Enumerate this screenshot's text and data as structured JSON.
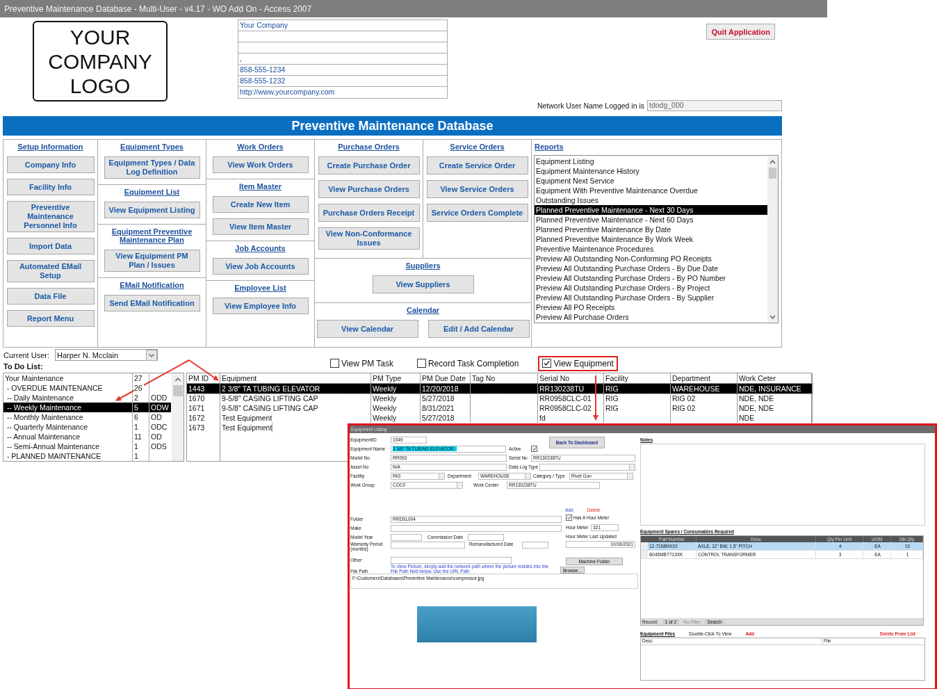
{
  "window": {
    "title": "Preventive Maintenance Database - Multi-User - v4.17 - WO Add On - Access 2007"
  },
  "logo": {
    "lines": [
      "YOUR",
      "COMPANY",
      "LOGO"
    ]
  },
  "company_info": [
    {
      "kind": "text",
      "value": "Your Company"
    },
    {
      "kind": "blank"
    },
    {
      "kind": "blank"
    },
    {
      "kind": "text",
      "value": ","
    },
    {
      "kind": "text",
      "value": "858-555-1234"
    },
    {
      "kind": "text",
      "value": "858-555-1232"
    },
    {
      "kind": "text",
      "value": "http://www.yourcompany.com"
    }
  ],
  "quit_button": "Quit Application",
  "network_user": {
    "label": "Network User Name Logged in is",
    "value": "tdodg_000"
  },
  "banner": "Preventive Maintenance Database",
  "menu_columns": [
    [
      {
        "heading": "Setup Information",
        "buttons": [
          "Company Info",
          "Facility Info",
          "Preventive Maintenance Personnel Info",
          "Import Data",
          "Automated EMail Setup",
          "Data File",
          "Report Menu"
        ]
      }
    ],
    [
      {
        "heading": "Equipment Types",
        "buttons": [
          "Equipment Types / Data Log Definition"
        ]
      },
      {
        "heading": "Equipment List",
        "buttons": [
          "View Equipment Listing"
        ]
      },
      {
        "heading": "Equipment Preventive Maintenance Plan",
        "buttons": [
          "View Equipment PM Plan / Issues"
        ]
      },
      {
        "heading": "EMail Notification",
        "buttons": [
          "Send EMail Notification"
        ]
      }
    ],
    [
      {
        "heading": "Work Orders",
        "buttons": [
          "View Work Orders"
        ]
      },
      {
        "heading": "Item Master",
        "buttons": [
          "Create New Item",
          "View Item Master"
        ]
      },
      {
        "heading": "Job Accounts",
        "buttons": [
          "View Job Accounts"
        ]
      },
      {
        "heading": "Employee List",
        "buttons": [
          "View Employee Info"
        ]
      }
    ]
  ],
  "order_columns": [
    {
      "heading": "Purchase Orders",
      "buttons": [
        "Create Purchase Order",
        "View Purchase Orders",
        "Purchase Orders Receipt",
        "View Non-Conformance Issues"
      ]
    },
    {
      "heading": "Service Orders",
      "buttons": [
        "Create Service Order",
        "View Service Orders",
        "Service Orders Complete"
      ]
    }
  ],
  "wide_sections": [
    {
      "heading": "Suppliers",
      "buttons": [
        "View Suppliers"
      ]
    },
    {
      "heading": "Calendar",
      "buttons": [
        "View Calendar",
        "Edit / Add Calendar"
      ]
    }
  ],
  "reports": {
    "heading": "Reports",
    "items": [
      {
        "label": "Equipment Listing",
        "selected": false
      },
      {
        "label": "Equipment Maintenance History",
        "selected": false
      },
      {
        "label": "Equipment Next Service",
        "selected": false
      },
      {
        "label": "Equipment With Preventive Maintenance Overdue",
        "selected": false
      },
      {
        "label": "Outstanding Issues",
        "selected": false
      },
      {
        "label": "Planned Preventive Maintenance - Next 30 Days",
        "selected": true
      },
      {
        "label": "Planned Preventive Maintenance - Next 60 Days",
        "selected": false
      },
      {
        "label": "Planned Preventive Maintenance By Date",
        "selected": false
      },
      {
        "label": "Planned Preventive Maintenance By Work Week",
        "selected": false
      },
      {
        "label": "Preventive Maintenance Procedures",
        "selected": false
      },
      {
        "label": "Preview All Outstanding Non-Conforming PO Receipts",
        "selected": false
      },
      {
        "label": "Preview All Outstanding Purchase Orders - By Due Date",
        "selected": false
      },
      {
        "label": "Preview All Outstanding Purchase Orders - By PO Number",
        "selected": false
      },
      {
        "label": "Preview All Outstanding Purchase Orders - By Project",
        "selected": false
      },
      {
        "label": "Preview All Outstanding Purchase Orders - By Supplier",
        "selected": false
      },
      {
        "label": "Preview All PO Receipts",
        "selected": false
      },
      {
        "label": "Preview All Purchase Orders",
        "selected": false
      }
    ]
  },
  "current_user": {
    "label": "Current User:",
    "value": "Harper N. Mcclain"
  },
  "checkboxes": [
    {
      "label": "View PM Task",
      "checked": false,
      "highlighted": false
    },
    {
      "label": "Record Task Completion",
      "checked": false,
      "highlighted": false
    },
    {
      "label": "View Equipment",
      "checked": true,
      "highlighted": true
    }
  ],
  "todo": {
    "title": "To Do List:",
    "rows": [
      {
        "cells": [
          "Your Maintenance",
          "27"
        ],
        "selected": false
      },
      {
        "cells": [
          " - OVERDUE MAINTENANCE",
          "26"
        ],
        "selected": false
      },
      {
        "cells": [
          " -- Daily Maintenance",
          "2",
          "ODD"
        ],
        "selected": false
      },
      {
        "cells": [
          " -- Weekly Maintenance",
          "5",
          "ODW"
        ],
        "selected": true
      },
      {
        "cells": [
          " -- Monthly Maintenance",
          "6",
          "OD"
        ],
        "selected": false
      },
      {
        "cells": [
          " -- Quarterly Maintenance",
          "1",
          "ODC"
        ],
        "selected": false
      },
      {
        "cells": [
          " -- Annual Maintenance",
          "11",
          "OD"
        ],
        "selected": false
      },
      {
        "cells": [
          " -- Semi-Annual Maintenance",
          "1",
          "ODS"
        ],
        "selected": false
      },
      {
        "cells": [
          " - PLANNED MAINTENANCE",
          "1"
        ],
        "selected": false
      }
    ]
  },
  "pm_table": {
    "columns": [
      "PM ID",
      "Equipment",
      "PM Type",
      "PM Due Date",
      "Tag No",
      "Serial No",
      "Facility",
      "Department",
      "Work Ceter"
    ],
    "rows": [
      {
        "cells": [
          "1443",
          "2 3/8\" TA TUBING ELEVATOR",
          "Weekly",
          "12/20/2018",
          "",
          "RR130238TU",
          "RIG",
          "WAREHOUSE",
          "NDE, INSURANCE"
        ],
        "selected": true
      },
      {
        "cells": [
          "1670",
          "9-5/8\" CASING LIFTING CAP",
          "Weekly",
          "5/27/2018",
          "",
          "RR0958CLC-01",
          "RIG",
          "RIG 02",
          "NDE, NDE"
        ],
        "selected": false
      },
      {
        "cells": [
          "1671",
          "9-5/8\" CASING LIFTING CAP",
          "Weekly",
          "8/31/2021",
          "",
          "RR0958CLC-02",
          "RIG",
          "RIG 02",
          "NDE, NDE"
        ],
        "selected": false
      },
      {
        "cells": [
          "1672",
          "Test Equipment",
          "Weekly",
          "5/27/2018",
          "",
          "fd",
          "",
          "",
          "NDE"
        ],
        "selected": false
      },
      {
        "cells": [
          "1673",
          "Test Equipment"
        ],
        "selected": false
      }
    ]
  },
  "equipment_form": {
    "title": "Equipment Listing",
    "equipment_id": {
      "label": "EquipmentID",
      "value": "1049"
    },
    "equipment_name": {
      "label": "Equipment Name",
      "value": "2 3/8\" TA TUBING ELEVATOR",
      "text_selected": true
    },
    "active": {
      "label": "Active",
      "checked": true
    },
    "back_button": "Back To Dashboard",
    "model_no": {
      "label": "Model No",
      "value": "RR093"
    },
    "serial_no": {
      "label": "Serial No",
      "value": "RR130238TU"
    },
    "asset_no": {
      "label": "Asset No",
      "value": "N/A"
    },
    "data_log_type": {
      "label": "Data Log Type"
    },
    "facility": {
      "label": "Facility",
      "value": "RIG"
    },
    "department": {
      "label": "Department",
      "value": "WAREHOUSE"
    },
    "category_type": {
      "label": "Category / Type",
      "value": "Rivet Gun"
    },
    "work_group": {
      "label": "Work Group",
      "value": "COC0"
    },
    "work_center": {
      "label": "Work Center",
      "value": "RR130238TU"
    },
    "links": [
      {
        "kind": "add",
        "label": "Add"
      },
      {
        "kind": "delete",
        "label": "Delete"
      }
    ],
    "folder": {
      "label": "Folder",
      "value": "RRDSL004"
    },
    "make": {
      "label": "Make"
    },
    "model_year": {
      "label": "Model Year"
    },
    "commission_date": {
      "label": "Commission Date"
    },
    "warranty_period": {
      "label": "Warranty Period (months)"
    },
    "remanufactured_date": {
      "label": "Remanufactured Date"
    },
    "other": {
      "label": "Other:"
    },
    "has_hour_meter": {
      "label": "Has A Hour Meter",
      "checked": true
    },
    "hour_meter": {
      "label": "Hour Meter",
      "value": "321"
    },
    "hour_meter_updated": {
      "label": "Hour Meter Last Updated",
      "value": "10/16/2021"
    },
    "machine_folder_button": "Machine Folder",
    "picture_hint": "To View Picture, simply add the network path where the picture resides into the File Path field below. Use the URL Path",
    "browse_button": "Browse...",
    "file_path": {
      "label": "File Path",
      "value": "F:\\Customers\\Databases\\Preventive Maintenance\\compressor.jpg"
    },
    "notes_label": "Notes",
    "spares": {
      "title": "Equipment Spares / Consumables Required",
      "columns": [
        "Part Number",
        "Desc",
        "Qty Per Unit",
        "UOM",
        "Stk Qty"
      ],
      "rows": [
        {
          "cells": [
            "12-7158MX02",
            "AXLE, 12\" BW, 1.5\" PITCH",
            "4",
            "EA",
            "10"
          ],
          "selected": true
        },
        {
          "cells": [
            "B045MBT713XK",
            "CONTROL TRANSFORMER",
            "3",
            "EA",
            "1"
          ],
          "selected": false
        }
      ]
    },
    "record_nav": {
      "label": "Record:",
      "position": "1 of 2",
      "filter": "No Filter",
      "search": "Search"
    },
    "files": {
      "title": "Equipment Files",
      "hint": "Double-Click To View",
      "add": "Add",
      "delete": "Delete From List",
      "columns": [
        "Desc",
        "File"
      ]
    }
  }
}
